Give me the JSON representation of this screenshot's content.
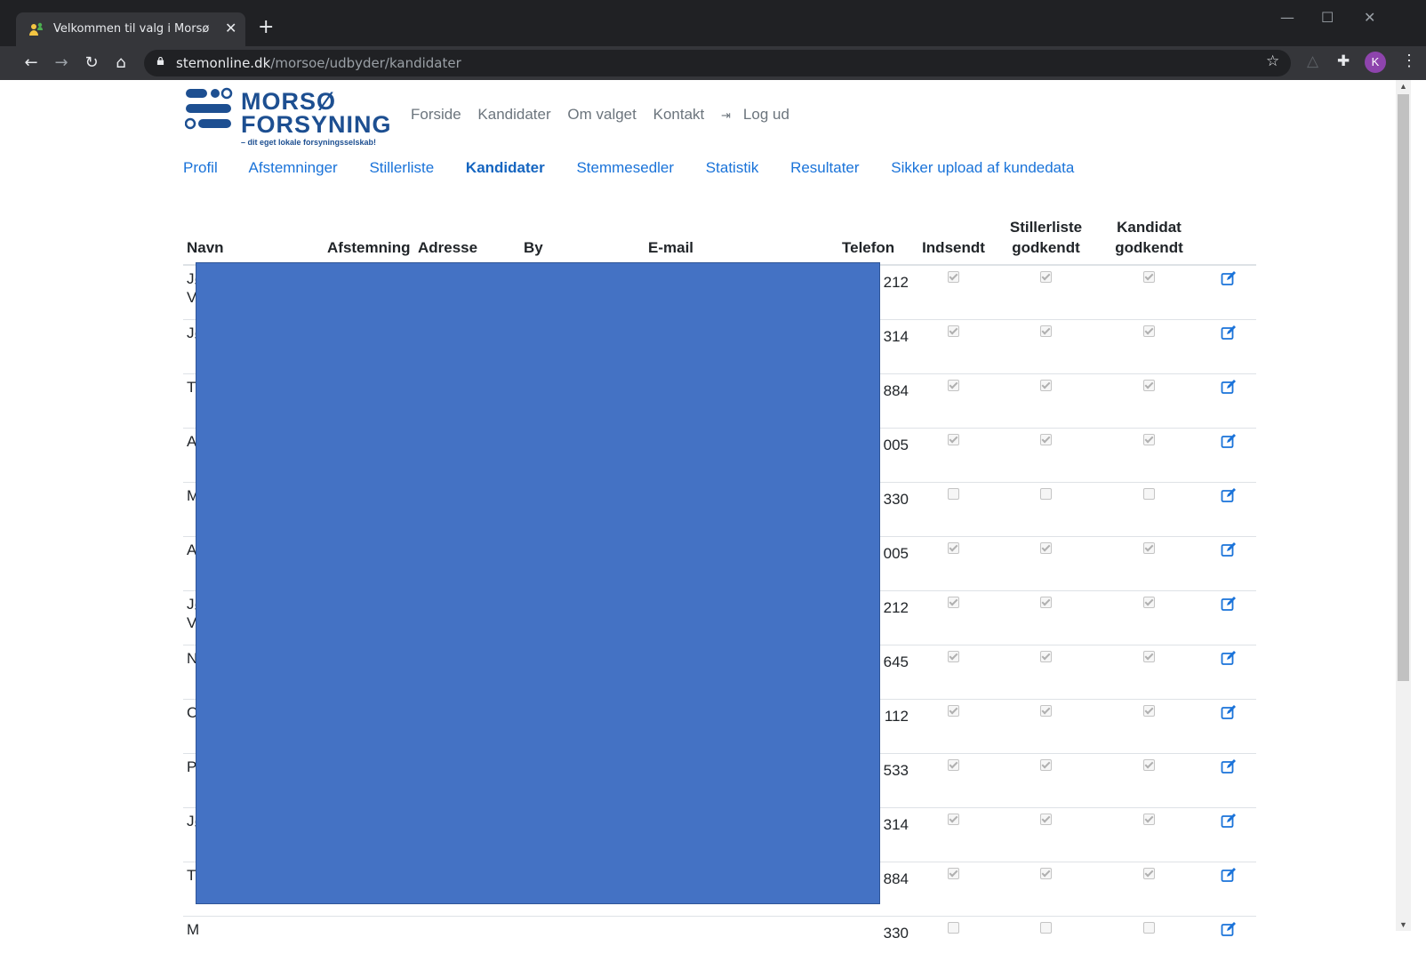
{
  "browser": {
    "tab_title": "Velkommen til valg i Morsø Forsy",
    "tab_close": "✕",
    "new_tab": "+",
    "url_host": "stemonline.dk",
    "url_path": "/morsoe/udbyder/kandidater",
    "profile_initial": "K"
  },
  "logo": {
    "line1": "MORSØ",
    "line2": "FORSYNING",
    "tagline": "– dit eget lokale forsyningsselskab!"
  },
  "topnav": [
    "Forside",
    "Kandidater",
    "Om valget",
    "Kontakt",
    "Log ud"
  ],
  "subnav": [
    "Profil",
    "Afstemninger",
    "Stillerliste",
    "Kandidater",
    "Stemmesedler",
    "Statistik",
    "Resultater",
    "Sikker upload af kundedata"
  ],
  "subnav_active": "Kandidater",
  "table": {
    "headers": {
      "navn": "Navn",
      "afstemning": "Afstemning",
      "adresse": "Adresse",
      "by": "By",
      "email": "E-mail",
      "telefon": "Telefon",
      "indsendt": "Indsendt",
      "stillerliste_1": "Stillerliste",
      "stillerliste_2": "godkendt",
      "kandidat_1": "Kandidat",
      "kandidat_2": "godkendt"
    },
    "rows": [
      {
        "navn": "Jø\nVi",
        "telefon": "212",
        "indsendt": true,
        "stillerliste": true,
        "kandidat": true
      },
      {
        "navn": "Jø",
        "telefon": "314",
        "indsendt": true,
        "stillerliste": true,
        "kandidat": true
      },
      {
        "navn": "Th",
        "telefon": "884",
        "indsendt": true,
        "stillerliste": true,
        "kandidat": true
      },
      {
        "navn": "Al",
        "telefon": "005",
        "indsendt": true,
        "stillerliste": true,
        "kandidat": true
      },
      {
        "navn": "M",
        "telefon": "330",
        "indsendt": false,
        "stillerliste": false,
        "kandidat": false
      },
      {
        "navn": "Al",
        "telefon": "005",
        "indsendt": true,
        "stillerliste": true,
        "kandidat": true
      },
      {
        "navn": "Jø\nVi",
        "telefon": "212",
        "indsendt": true,
        "stillerliste": true,
        "kandidat": true
      },
      {
        "navn": "N",
        "telefon": "645",
        "indsendt": true,
        "stillerliste": true,
        "kandidat": true
      },
      {
        "navn": "Cl",
        "telefon": "112",
        "indsendt": true,
        "stillerliste": true,
        "kandidat": true
      },
      {
        "navn": "Po",
        "telefon": "533",
        "indsendt": true,
        "stillerliste": true,
        "kandidat": true
      },
      {
        "navn": "Jø",
        "telefon": "314",
        "indsendt": true,
        "stillerliste": true,
        "kandidat": true
      },
      {
        "navn": "Th",
        "telefon": "884",
        "indsendt": true,
        "stillerliste": true,
        "kandidat": true
      },
      {
        "navn": "M",
        "telefon": "330",
        "indsendt": false,
        "stillerliste": false,
        "kandidat": false
      }
    ]
  },
  "colors": {
    "link": "#1a73d9",
    "logo": "#1d4f91",
    "redaction": "#4472c4"
  }
}
